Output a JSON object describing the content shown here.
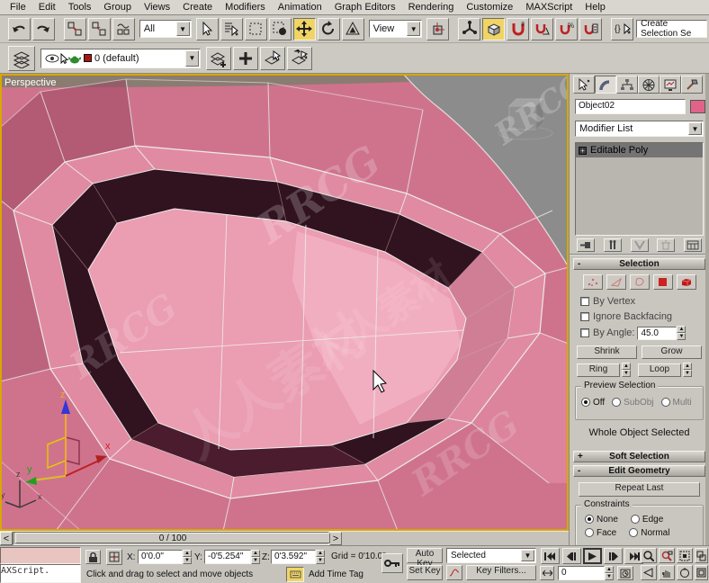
{
  "menu": {
    "items": [
      "File",
      "Edit",
      "Tools",
      "Group",
      "Views",
      "Create",
      "Modifiers",
      "Animation",
      "Graph Editors",
      "Rendering",
      "Customize",
      "MAXScript",
      "Help"
    ]
  },
  "toolbar": {
    "selection_filter": "All",
    "coord_system": "View",
    "named_selection_placeholder": "Create Selection Se",
    "layer_dropdown": "0 (default)"
  },
  "viewport": {
    "label": "Perspective",
    "watermark_rrcg": "RRCG",
    "watermark_cn": "人人素材",
    "axis_x": "x",
    "axis_y": "y",
    "axis_z": "z"
  },
  "panel": {
    "object_name": "Object02",
    "object_color": "#e0648a",
    "modifier_list_label": "Modifier List",
    "stack_item": "Editable Poly",
    "selection": {
      "title": "Selection",
      "by_vertex": "By Vertex",
      "ignore_backfacing": "Ignore Backfacing",
      "by_angle": "By Angle:",
      "by_angle_value": "45.0",
      "shrink": "Shrink",
      "grow": "Grow",
      "ring": "Ring",
      "loop": "Loop",
      "preview_title": "Preview Selection",
      "preview_off": "Off",
      "preview_subobj": "SubObj",
      "preview_multi": "Multi",
      "status": "Whole Object Selected"
    },
    "rollouts": {
      "soft_selection": "Soft Selection",
      "edit_geometry": "Edit Geometry",
      "repeat_last": "Repeat Last",
      "constraints_title": "Constraints",
      "c_none": "None",
      "c_edge": "Edge",
      "c_face": "Face",
      "c_normal": "Normal"
    }
  },
  "timeline": {
    "range": "0 / 100",
    "prev": "<",
    "next": ">"
  },
  "status": {
    "listener": "AXScript.",
    "x_label": "X:",
    "x": "0'0.0\"",
    "y_label": "Y:",
    "y": "-0'5.254\"",
    "z_label": "Z:",
    "z": "0'3.592\"",
    "grid": "Grid = 0'10.0\"",
    "prompt": "Click and drag to select and move objects",
    "add_time_tag": "Add Time Tag"
  },
  "anim": {
    "auto_key": "Auto Key",
    "set_key": "Set Key",
    "key_mode": "Selected",
    "key_filters": "Key Filters...",
    "frame": "0"
  }
}
